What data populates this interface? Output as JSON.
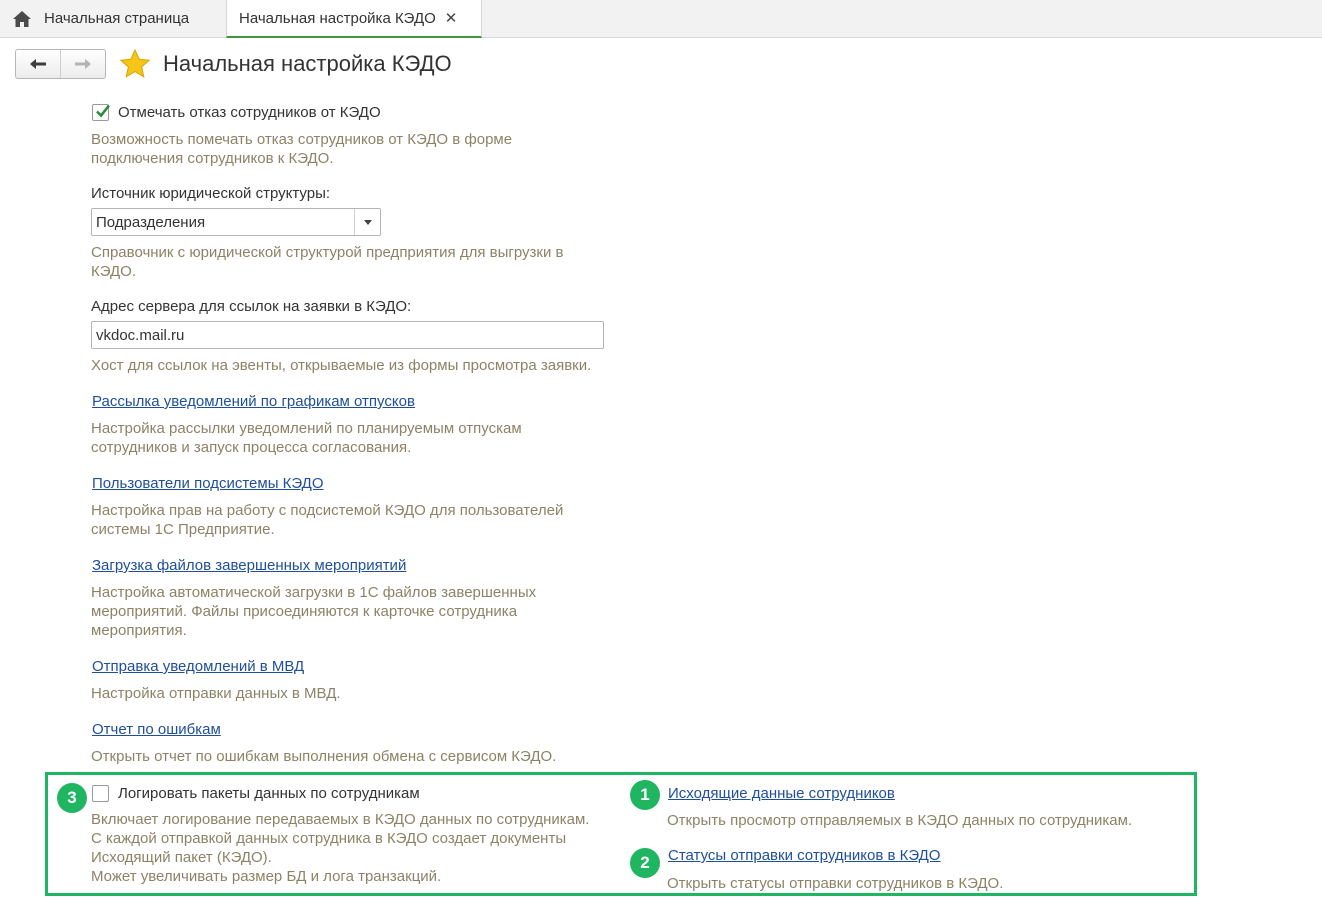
{
  "tabs": {
    "home_label": "Начальная страница",
    "active_label": "Начальная настройка КЭДО",
    "close_glyph": "✕"
  },
  "header": {
    "title": "Начальная настройка КЭДО"
  },
  "settings": {
    "refusal_checkbox": {
      "label": "Отмечать отказ сотрудников от КЭДО",
      "checked": true,
      "desc_lines": [
        "Возможность помечать отказ сотрудников от КЭДО в форме",
        "подключения сотрудников к КЭДО."
      ]
    },
    "legal_source": {
      "label": "Источник юридической структуры:",
      "value": "Подразделения",
      "desc_lines": [
        "Справочник с юридической структурой предприятия для выгрузки в",
        "КЭДО."
      ]
    },
    "server_address": {
      "label": "Адрес сервера для ссылок на заявки в КЭДО:",
      "value": "vkdoc.mail.ru",
      "desc_lines": [
        "Хост для ссылок на эвенты, открываемые из формы просмотра заявки."
      ]
    },
    "links": [
      {
        "label": "Рассылка уведомлений по графикам отпусков",
        "desc_lines": [
          "Настройка рассылки уведомлений по планируемым отпускам",
          "сотрудников и запуск процесса согласования."
        ]
      },
      {
        "label": "Пользователи подсистемы КЭДО",
        "desc_lines": [
          "Настройка прав на работу с подсистемой КЭДО для пользователей",
          "системы 1С Предприятие."
        ]
      },
      {
        "label": "Загрузка файлов завершенных мероприятий",
        "desc_lines": [
          "Настройка автоматической загрузки в 1С файлов завершенных",
          "мероприятий. Файлы присоединяются к карточке сотрудника",
          "мероприятия."
        ]
      },
      {
        "label": "Отправка уведомлений в МВД",
        "desc_lines": [
          "Настройка отправки данных в МВД."
        ]
      },
      {
        "label": "Отчет по ошибкам",
        "desc_lines": [
          "Открыть отчет по ошибкам выполнения обмена с сервисом КЭДО."
        ]
      }
    ]
  },
  "highlight": {
    "color": "#20b661",
    "log_packets": {
      "badge": "3",
      "label": "Логировать пакеты данных по сотрудникам",
      "checked": false,
      "desc_lines": [
        "Включает логирование передаваемых в КЭДО данных по сотрудникам.",
        "С каждой отправкой данных сотрудника в КЭДО создает документы",
        "Исходящий пакет (КЭДО).",
        "Может увеличивать размер БД и лога транзакций."
      ]
    },
    "outgoing_data": {
      "badge": "1",
      "label": "Исходящие данные сотрудников",
      "desc": "Открыть просмотр отправляемых в КЭДО данных по сотрудникам."
    },
    "send_statuses": {
      "badge": "2",
      "label": "Статусы отправки сотрудников в КЭДО",
      "desc": "Открыть статусы отправки сотрудников в КЭДО."
    }
  }
}
